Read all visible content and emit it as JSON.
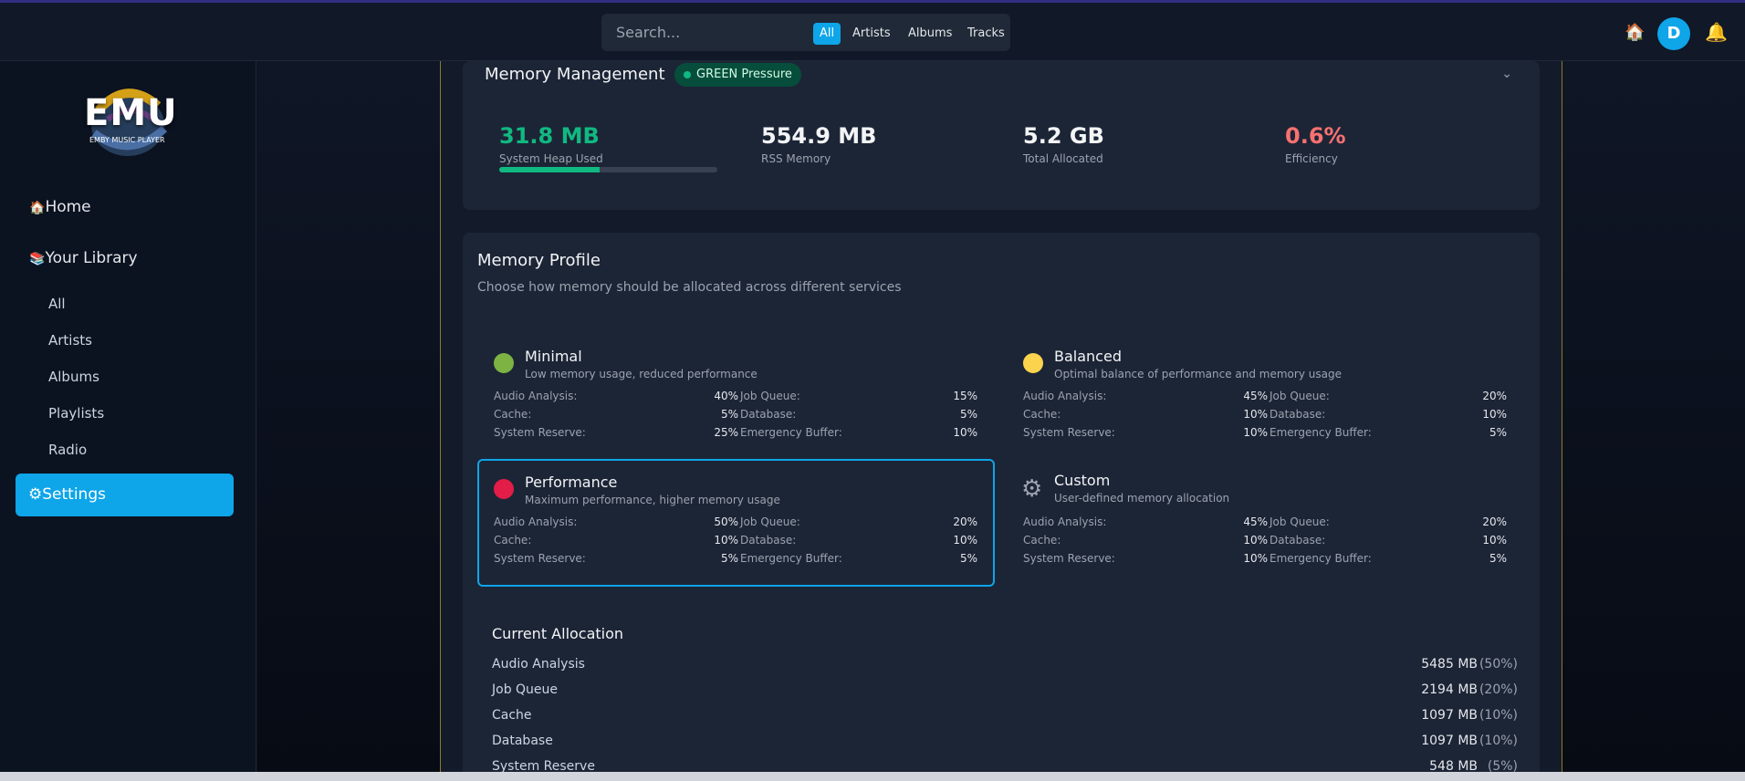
{
  "topbar": {
    "search_placeholder": "Search...",
    "filters": [
      "All",
      "Artists",
      "Albums",
      "Tracks"
    ],
    "avatar_initial": "D",
    "home_icon": "🏠",
    "bell_icon": "🔔"
  },
  "sidebar": {
    "logo_text": "EMU",
    "logo_sub": "EMBY MUSIC PLAYER",
    "home": "Home",
    "home_icon": "🏠",
    "library": "Your Library",
    "library_icon": "📚",
    "items": [
      "All",
      "Artists",
      "Albums",
      "Playlists",
      "Radio"
    ],
    "settings": "Settings",
    "settings_icon": "⚙"
  },
  "memory": {
    "title": "Memory Management",
    "pressure": "GREEN Pressure",
    "heap_value": "31.8 MB",
    "heap_label": "System Heap Used",
    "heap_fraction": 0.46,
    "rss_value": "554.9 MB",
    "rss_label": "RSS Memory",
    "total_value": "5.2 GB",
    "total_label": "Total Allocated",
    "eff_value": "0.6%",
    "eff_label": "Efficiency",
    "colors": {
      "green": "#10b981",
      "red": "#f87171",
      "accent": "#0ea5e9"
    }
  },
  "profile": {
    "title": "Memory Profile",
    "subtitle": "Choose how memory should be allocated across different services",
    "profiles": [
      {
        "name": "Minimal",
        "desc": "Low memory usage, reduced performance",
        "rows": [
          [
            "Audio Analysis:",
            "40%",
            "Job Queue:",
            "15%"
          ],
          [
            "Cache:",
            "5%",
            "Database:",
            "5%"
          ],
          [
            "System Reserve:",
            "25%",
            "Emergency Buffer:",
            "10%"
          ]
        ]
      },
      {
        "name": "Balanced",
        "desc": "Optimal balance of performance and memory usage",
        "rows": [
          [
            "Audio Analysis:",
            "45%",
            "Job Queue:",
            "20%"
          ],
          [
            "Cache:",
            "10%",
            "Database:",
            "10%"
          ],
          [
            "System Reserve:",
            "10%",
            "Emergency Buffer:",
            "5%"
          ]
        ]
      },
      {
        "name": "Performance",
        "desc": "Maximum performance, higher memory usage",
        "rows": [
          [
            "Audio Analysis:",
            "50%",
            "Job Queue:",
            "20%"
          ],
          [
            "Cache:",
            "10%",
            "Database:",
            "10%"
          ],
          [
            "System Reserve:",
            "5%",
            "Emergency Buffer:",
            "5%"
          ]
        ]
      },
      {
        "name": "Custom",
        "desc": "User-defined memory allocation",
        "rows": [
          [
            "Audio Analysis:",
            "45%",
            "Job Queue:",
            "20%"
          ],
          [
            "Cache:",
            "10%",
            "Database:",
            "10%"
          ],
          [
            "System Reserve:",
            "10%",
            "Emergency Buffer:",
            "5%"
          ]
        ]
      }
    ]
  },
  "allocation": {
    "title": "Current Allocation",
    "rows": [
      [
        "Audio Analysis",
        "5485 MB",
        "(50%)"
      ],
      [
        "Job Queue",
        "2194 MB",
        "(20%)"
      ],
      [
        "Cache",
        "1097 MB",
        "(10%)"
      ],
      [
        "Database",
        "1097 MB",
        "(10%)"
      ],
      [
        "System Reserve",
        "548 MB",
        "(5%)"
      ]
    ]
  }
}
